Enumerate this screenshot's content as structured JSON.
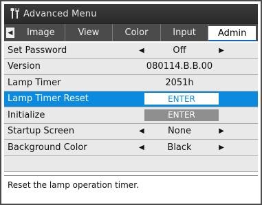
{
  "window": {
    "title": "Advanced Menu",
    "icon": "tools-icon"
  },
  "tabs": [
    {
      "label": "Image",
      "active": false
    },
    {
      "label": "View",
      "active": false
    },
    {
      "label": "Color",
      "active": false
    },
    {
      "label": "Input",
      "active": false
    },
    {
      "label": "Admin",
      "active": true
    }
  ],
  "menu": {
    "items": [
      {
        "label": "Set Password",
        "value": "Off"
      },
      {
        "label": "Version",
        "value": "080114.B.B.00"
      },
      {
        "label": "Lamp Timer",
        "value": "2051h"
      },
      {
        "label": "Lamp Timer Reset",
        "value": "ENTER"
      },
      {
        "label": "Initialize",
        "value": "ENTER"
      },
      {
        "label": "Startup Screen",
        "value": "None"
      },
      {
        "label": "Background Color",
        "value": "Black"
      }
    ]
  },
  "help": {
    "text": "Reset the lamp operation timer."
  },
  "colors": {
    "selected_row": "#0b8be0",
    "title_bar": "#2f2f2f",
    "tab_bar": "#4b4b4b",
    "menu_bg": "#e9e9e9"
  }
}
